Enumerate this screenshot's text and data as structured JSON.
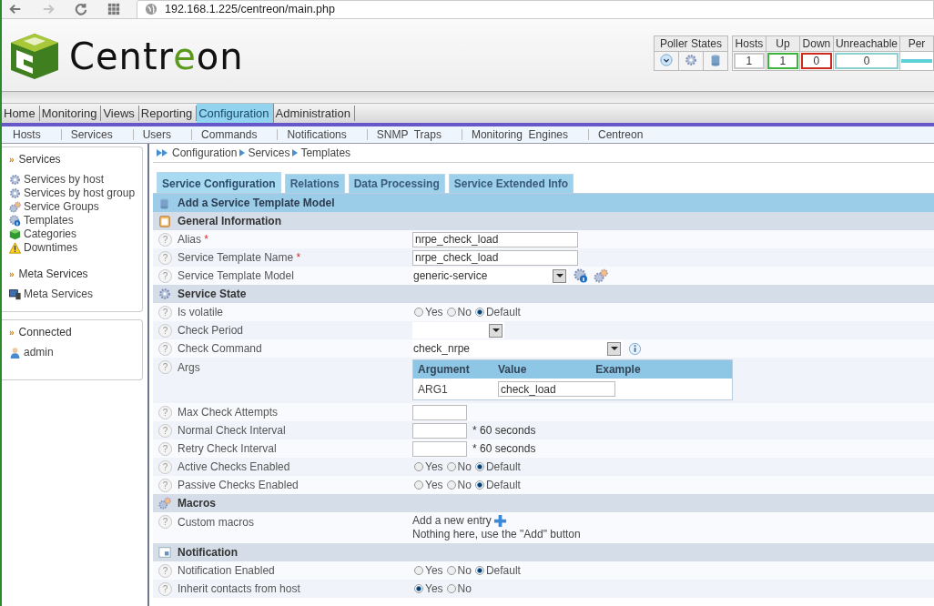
{
  "browser": {
    "url": "192.168.1.225/centreon/main.php"
  },
  "header": {
    "logo": [
      {
        "text": "Centr",
        "accent": false
      },
      {
        "text": "e",
        "accent": true
      },
      {
        "text": "on",
        "accent": false
      }
    ],
    "poller_states": {
      "title": "Poller States"
    },
    "host_stats": [
      {
        "label": "Hosts",
        "value": "1",
        "color": "#c8c8c8"
      },
      {
        "label": "Up",
        "value": "1",
        "color": "#3cb43c"
      },
      {
        "label": "Down",
        "value": "0",
        "color": "#cc2a1e"
      },
      {
        "label": "Unreachable",
        "value": "0",
        "color": "#8ccfd0"
      },
      {
        "label": "Per",
        "color": "#5fd0d8"
      }
    ]
  },
  "menu": [
    {
      "label": "Home",
      "selected": false
    },
    {
      "label": "Monitoring",
      "selected": false
    },
    {
      "label": "Views",
      "selected": false
    },
    {
      "label": "Reporting",
      "selected": false
    },
    {
      "label": "Configuration",
      "selected": true
    },
    {
      "label": "Administration",
      "selected": false
    }
  ],
  "submenu": [
    "Hosts",
    "Services",
    "Users",
    "Commands",
    "Notifications",
    "SNMP  Traps",
    "Monitoring  Engines",
    "Centreon"
  ],
  "sidebar": [
    {
      "marker": "»",
      "title": "Services",
      "items": [
        {
          "label": "Services by host",
          "kind": "gear"
        },
        {
          "label": "Services by host group",
          "kind": "gear"
        },
        {
          "label": "Service Groups",
          "kind": "gears"
        },
        {
          "label": "Templates",
          "kind": "template"
        },
        {
          "label": "Categories",
          "kind": "cube"
        },
        {
          "label": "Downtimes",
          "kind": "warning"
        }
      ]
    },
    {
      "marker": "»",
      "title": "Meta Services",
      "items": [
        {
          "label": "Meta Services",
          "kind": "monitor"
        }
      ]
    },
    {
      "marker": "»",
      "title": "Connected",
      "items": [
        {
          "label": "admin",
          "kind": "user"
        }
      ]
    }
  ],
  "breadcrumb": [
    "Configuration",
    "Services",
    "Templates"
  ],
  "tabs": [
    {
      "label": "Service Configuration",
      "selected": true
    },
    {
      "label": "Relations",
      "selected": false
    },
    {
      "label": "Data Processing",
      "selected": false
    },
    {
      "label": "Service Extended Info",
      "selected": false
    }
  ],
  "form": {
    "title": "Add a Service Template Model",
    "required_mark": "*",
    "sections": [
      {
        "title": "General Information",
        "kind": "clipboard",
        "rows": [
          {
            "kind": "text",
            "help": "?",
            "label": "Alias",
            "required": true,
            "value": "nrpe_check_load"
          },
          {
            "kind": "text",
            "help": "?",
            "label": "Service Template Name",
            "required": true,
            "value": "nrpe_check_load"
          },
          {
            "kind": "select",
            "help": "?",
            "label": "Service Template Model",
            "required": false,
            "value": "generic-service",
            "tools": true,
            "info": false
          }
        ]
      },
      {
        "title": "Service State",
        "kind": "gear",
        "rows": [
          {
            "kind": "radio",
            "help": "?",
            "label": "Is volatile",
            "required": false,
            "options": [
              {
                "label": "Yes",
                "selected": false
              },
              {
                "label": "No",
                "selected": false
              },
              {
                "label": "Default",
                "selected": true
              }
            ]
          },
          {
            "kind": "select",
            "help": "?",
            "label": "Check Period",
            "required": false,
            "value": "",
            "tools": false,
            "info": false
          },
          {
            "kind": "select",
            "help": "?",
            "label": "Check Command",
            "required": false,
            "value": "check_nrpe",
            "tools": false,
            "info": true
          },
          {
            "kind": "args",
            "help": "?",
            "label": "Args",
            "required": false,
            "columns": [
              "Argument",
              "Value",
              "Example"
            ],
            "rows": [
              {
                "name": "ARG1",
                "value": "check_load"
              }
            ]
          },
          {
            "kind": "number",
            "help": "?",
            "label": "Max Check Attempts",
            "required": false
          },
          {
            "kind": "number",
            "help": "?",
            "label": "Normal Check Interval",
            "required": false,
            "suffix": "* 60 seconds"
          },
          {
            "kind": "number",
            "help": "?",
            "label": "Retry Check Interval",
            "required": false,
            "suffix": "* 60 seconds"
          },
          {
            "kind": "radio",
            "help": "?",
            "label": "Active Checks Enabled",
            "required": false,
            "options": [
              {
                "label": "Yes",
                "selected": false
              },
              {
                "label": "No",
                "selected": false
              },
              {
                "label": "Default",
                "selected": true
              }
            ]
          },
          {
            "kind": "radio",
            "help": "?",
            "label": "Passive Checks Enabled",
            "required": false,
            "options": [
              {
                "label": "Yes",
                "selected": false
              },
              {
                "label": "No",
                "selected": false
              },
              {
                "label": "Default",
                "selected": true
              }
            ]
          }
        ]
      },
      {
        "title": "Macros",
        "kind": "gears",
        "rows": [
          {
            "kind": "macros",
            "help": "?",
            "label": "Custom macros",
            "required": false,
            "link": "Add a new entry",
            "note": "Nothing here, use the \"Add\" button"
          }
        ]
      },
      {
        "title": "Notification",
        "kind": "panel",
        "rows": [
          {
            "kind": "radio",
            "help": "?",
            "label": "Notification Enabled",
            "required": false,
            "options": [
              {
                "label": "Yes",
                "selected": false
              },
              {
                "label": "No",
                "selected": false
              },
              {
                "label": "Default",
                "selected": true
              }
            ]
          },
          {
            "kind": "radio",
            "help": "?",
            "label": "Inherit contacts from host",
            "required": false,
            "options": [
              {
                "label": "Yes",
                "selected": true
              },
              {
                "label": "No",
                "selected": false
              }
            ]
          }
        ]
      }
    ]
  }
}
